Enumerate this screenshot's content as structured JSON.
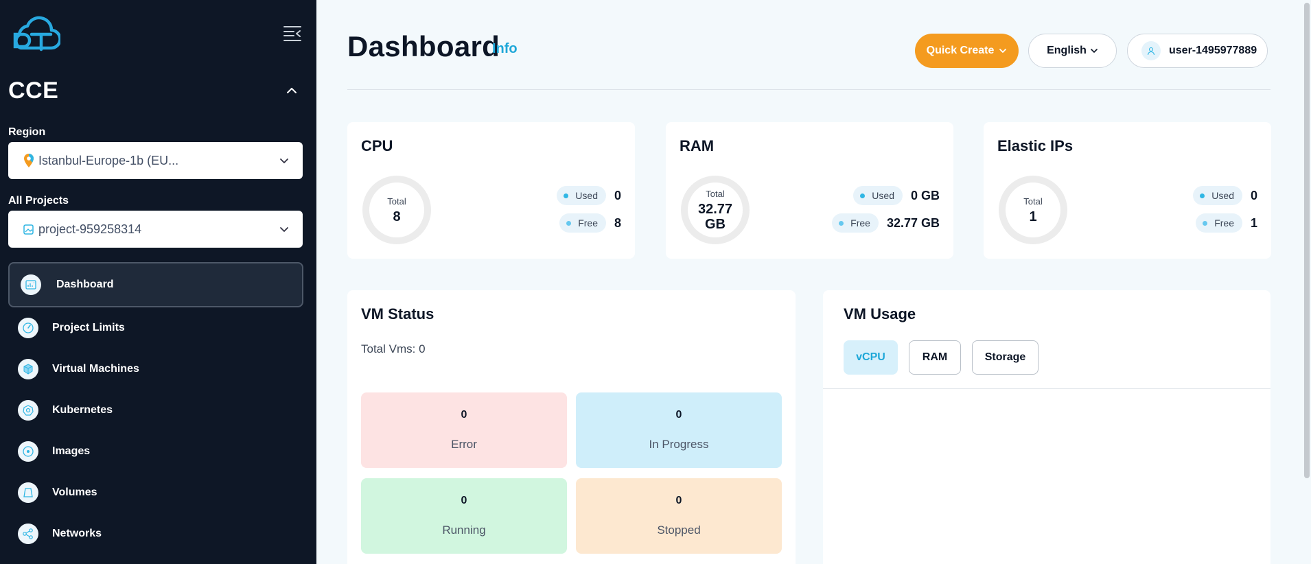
{
  "sidebar": {
    "logo": "cloud-logo",
    "section_title": "CCE",
    "region": {
      "label": "Region",
      "value": "Istanbul-Europe-1b (EU..."
    },
    "projects": {
      "label": "All Projects",
      "value": "project-959258314"
    },
    "items": [
      {
        "label": "Dashboard",
        "icon": "dashboard-icon",
        "active": true
      },
      {
        "label": "Project Limits",
        "icon": "gauge-icon"
      },
      {
        "label": "Virtual Machines",
        "icon": "cube-icon"
      },
      {
        "label": "Kubernetes",
        "icon": "kubernetes-icon"
      },
      {
        "label": "Images",
        "icon": "disc-icon"
      },
      {
        "label": "Volumes",
        "icon": "volume-icon"
      },
      {
        "label": "Networks",
        "icon": "share-network-icon"
      }
    ]
  },
  "header": {
    "title": "Dashboard",
    "info": "Info",
    "quick_create": "Quick Create",
    "language": "English",
    "user": "user-1495977889"
  },
  "stats": {
    "cpu": {
      "title": "CPU",
      "total_label": "Total",
      "total": "8",
      "used_label": "Used",
      "used": "0",
      "free_label": "Free",
      "free": "8"
    },
    "ram": {
      "title": "RAM",
      "total_label": "Total",
      "total": "32.77",
      "total_unit": "GB",
      "used_label": "Used",
      "used": "0 GB",
      "free_label": "Free",
      "free": "32.77 GB"
    },
    "eip": {
      "title": "Elastic IPs",
      "total_label": "Total",
      "total": "1",
      "used_label": "Used",
      "used": "0",
      "free_label": "Free",
      "free": "1"
    }
  },
  "vm_status": {
    "title": "VM Status",
    "total": "Total Vms: 0",
    "boxes": {
      "error": {
        "count": "0",
        "label": "Error",
        "color": "#fde3e3"
      },
      "in_progress": {
        "count": "0",
        "label": "In Progress",
        "color": "#cfeefa"
      },
      "running": {
        "count": "0",
        "label": "Running",
        "color": "#d1f6df"
      },
      "stopped": {
        "count": "0",
        "label": "Stopped",
        "color": "#fde8d0"
      }
    }
  },
  "vm_usage": {
    "title": "VM Usage",
    "tabs": [
      "vCPU",
      "RAM",
      "Storage"
    ],
    "active_tab": "vCPU"
  },
  "colors": {
    "sidebar_bg": "#0e1726",
    "accent": "#1ea7d8",
    "quick_create": "#f49b1f",
    "page_bg": "#f3f9fc"
  }
}
